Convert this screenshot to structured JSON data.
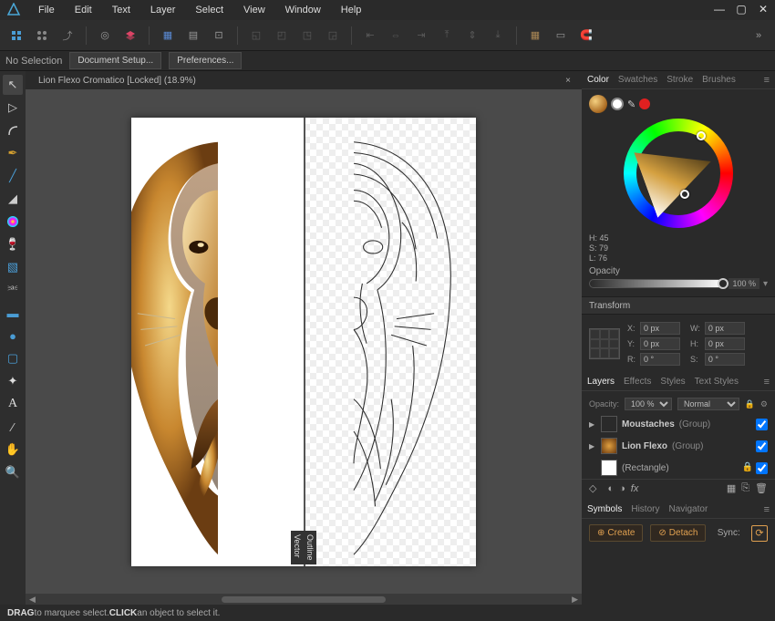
{
  "menu": {
    "items": [
      "File",
      "Edit",
      "Text",
      "Layer",
      "Select",
      "View",
      "Window",
      "Help"
    ]
  },
  "context": {
    "selection": "No Selection",
    "btn1": "Document Setup...",
    "btn2": "Preferences..."
  },
  "document": {
    "title": "Lion Flexo Cromatico [Locked] (18.9%)",
    "split_left": "Vector",
    "split_right": "Outline"
  },
  "color": {
    "tabs": [
      "Color",
      "Swatches",
      "Stroke",
      "Brushes"
    ],
    "h": "H: 45",
    "s": "S: 79",
    "l": "L: 76",
    "opacity_label": "Opacity",
    "opacity_value": "100 %"
  },
  "transform": {
    "title": "Transform",
    "x_label": "X:",
    "x": "0 px",
    "w_label": "W:",
    "w": "0 px",
    "y_label": "Y:",
    "y": "0 px",
    "h_label": "H:",
    "h": "0 px",
    "r_label": "R:",
    "r": "0 °",
    "s_label": "S:",
    "s": "0 °"
  },
  "layers": {
    "tabs": [
      "Layers",
      "Effects",
      "Styles",
      "Text Styles"
    ],
    "opacity_label": "Opacity:",
    "opacity_value": "100 %",
    "blend": "Normal",
    "items": [
      {
        "name": "Moustaches",
        "type": "(Group)",
        "thumb": "#2a2a2a"
      },
      {
        "name": "Lion Flexo",
        "type": "(Group)",
        "thumb": "lion"
      },
      {
        "name": "(Rectangle)",
        "type": "",
        "thumb": "#ffffff"
      }
    ]
  },
  "symbols": {
    "tabs": [
      "Symbols",
      "History",
      "Navigator"
    ],
    "create": "Create",
    "detach": "Detach",
    "sync": "Sync:"
  },
  "status": {
    "drag": "DRAG",
    "drag_txt": " to marquee select. ",
    "click": "CLICK",
    "click_txt": " an object to select it."
  }
}
